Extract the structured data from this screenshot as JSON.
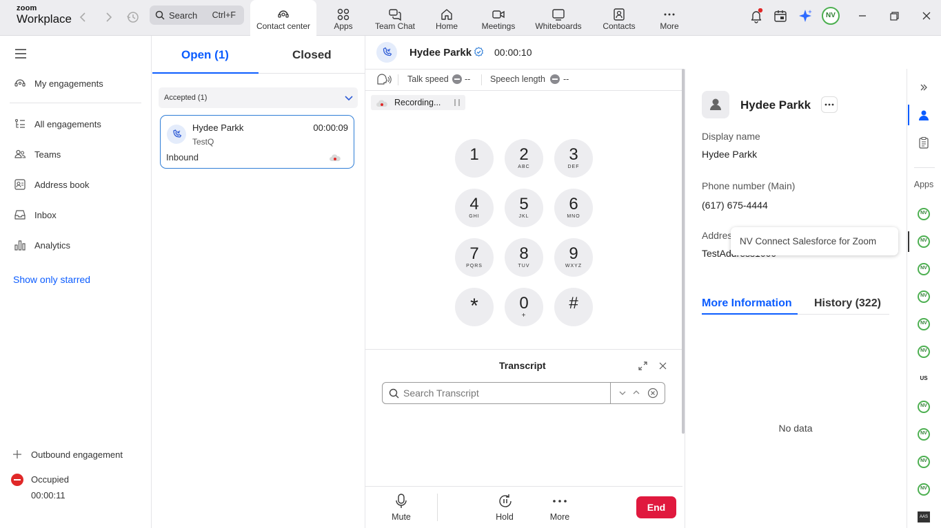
{
  "app": {
    "logo_top": "zoom",
    "logo_bottom": "Workplace"
  },
  "search": {
    "label": "Search",
    "shortcut": "Ctrl+F"
  },
  "tabs": [
    {
      "label": "Contact center",
      "icon": "contact-center-icon",
      "active": true
    },
    {
      "label": "Apps",
      "icon": "apps-icon"
    },
    {
      "label": "Team Chat",
      "icon": "chat-icon"
    },
    {
      "label": "Home",
      "icon": "home-icon"
    },
    {
      "label": "Meetings",
      "icon": "video-icon"
    },
    {
      "label": "Whiteboards",
      "icon": "whiteboard-icon"
    },
    {
      "label": "Contacts",
      "icon": "contacts-icon"
    },
    {
      "label": "More",
      "icon": "more-icon"
    }
  ],
  "user_avatar": "NV",
  "sidebar": {
    "items": [
      {
        "label": "My engagements",
        "icon": "headset-icon"
      },
      {
        "label": "All engagements",
        "icon": "list-icon"
      },
      {
        "label": "Teams",
        "icon": "teams-icon"
      },
      {
        "label": "Address book",
        "icon": "address-book-icon"
      },
      {
        "label": "Inbox",
        "icon": "inbox-icon"
      },
      {
        "label": "Analytics",
        "icon": "analytics-icon"
      }
    ],
    "show_starred": "Show only starred",
    "outbound": "Outbound engagement",
    "status": "Occupied",
    "status_timer": "00:00:11",
    "status_color": "#e02828"
  },
  "list": {
    "open_tab": "Open (1)",
    "closed_tab": "Closed",
    "group": "Accepted (1)",
    "card": {
      "name": "Hydee Parkk",
      "timer": "00:00:09",
      "queue": "TestQ",
      "direction": "Inbound"
    }
  },
  "call": {
    "name": "Hydee Parkk",
    "timer": "00:00:10",
    "talk_speed_label": "Talk speed",
    "talk_speed_value": "--",
    "speech_length_label": "Speech length",
    "speech_length_value": "--",
    "recording": "Recording..."
  },
  "dialpad": [
    {
      "n": "1",
      "l": ""
    },
    {
      "n": "2",
      "l": "ABC"
    },
    {
      "n": "3",
      "l": "DEF"
    },
    {
      "n": "4",
      "l": "GHI"
    },
    {
      "n": "5",
      "l": "JKL"
    },
    {
      "n": "6",
      "l": "MNO"
    },
    {
      "n": "7",
      "l": "PQRS"
    },
    {
      "n": "8",
      "l": "TUV"
    },
    {
      "n": "9",
      "l": "WXYZ"
    },
    {
      "n": "*",
      "l": ""
    },
    {
      "n": "0",
      "l": "+"
    },
    {
      "n": "#",
      "l": ""
    }
  ],
  "transcript": {
    "title": "Transcript",
    "placeholder": "Search Transcript"
  },
  "controls": {
    "mute": "Mute",
    "hold": "Hold",
    "more": "More",
    "end": "End",
    "end_color": "#e0193e"
  },
  "profile": {
    "name": "Hydee Parkk",
    "display_name_label": "Display name",
    "display_name": "Hydee Parkk",
    "phone_label": "Phone number (Main)",
    "phone": "(617) 675-4444",
    "address_label": "Address",
    "address": "TestAddress1000",
    "tooltip": "NV Connect Salesforce for Zoom",
    "tab_more": "More Information",
    "tab_history": "History (322)",
    "empty": "No data"
  },
  "rail": {
    "apps_label": "Apps",
    "us_label": "US",
    "last_label": "AAS"
  },
  "colors": {
    "accent": "#0b5cff",
    "card_border": "#2d7cd6",
    "nv_green": "#4caf50"
  }
}
